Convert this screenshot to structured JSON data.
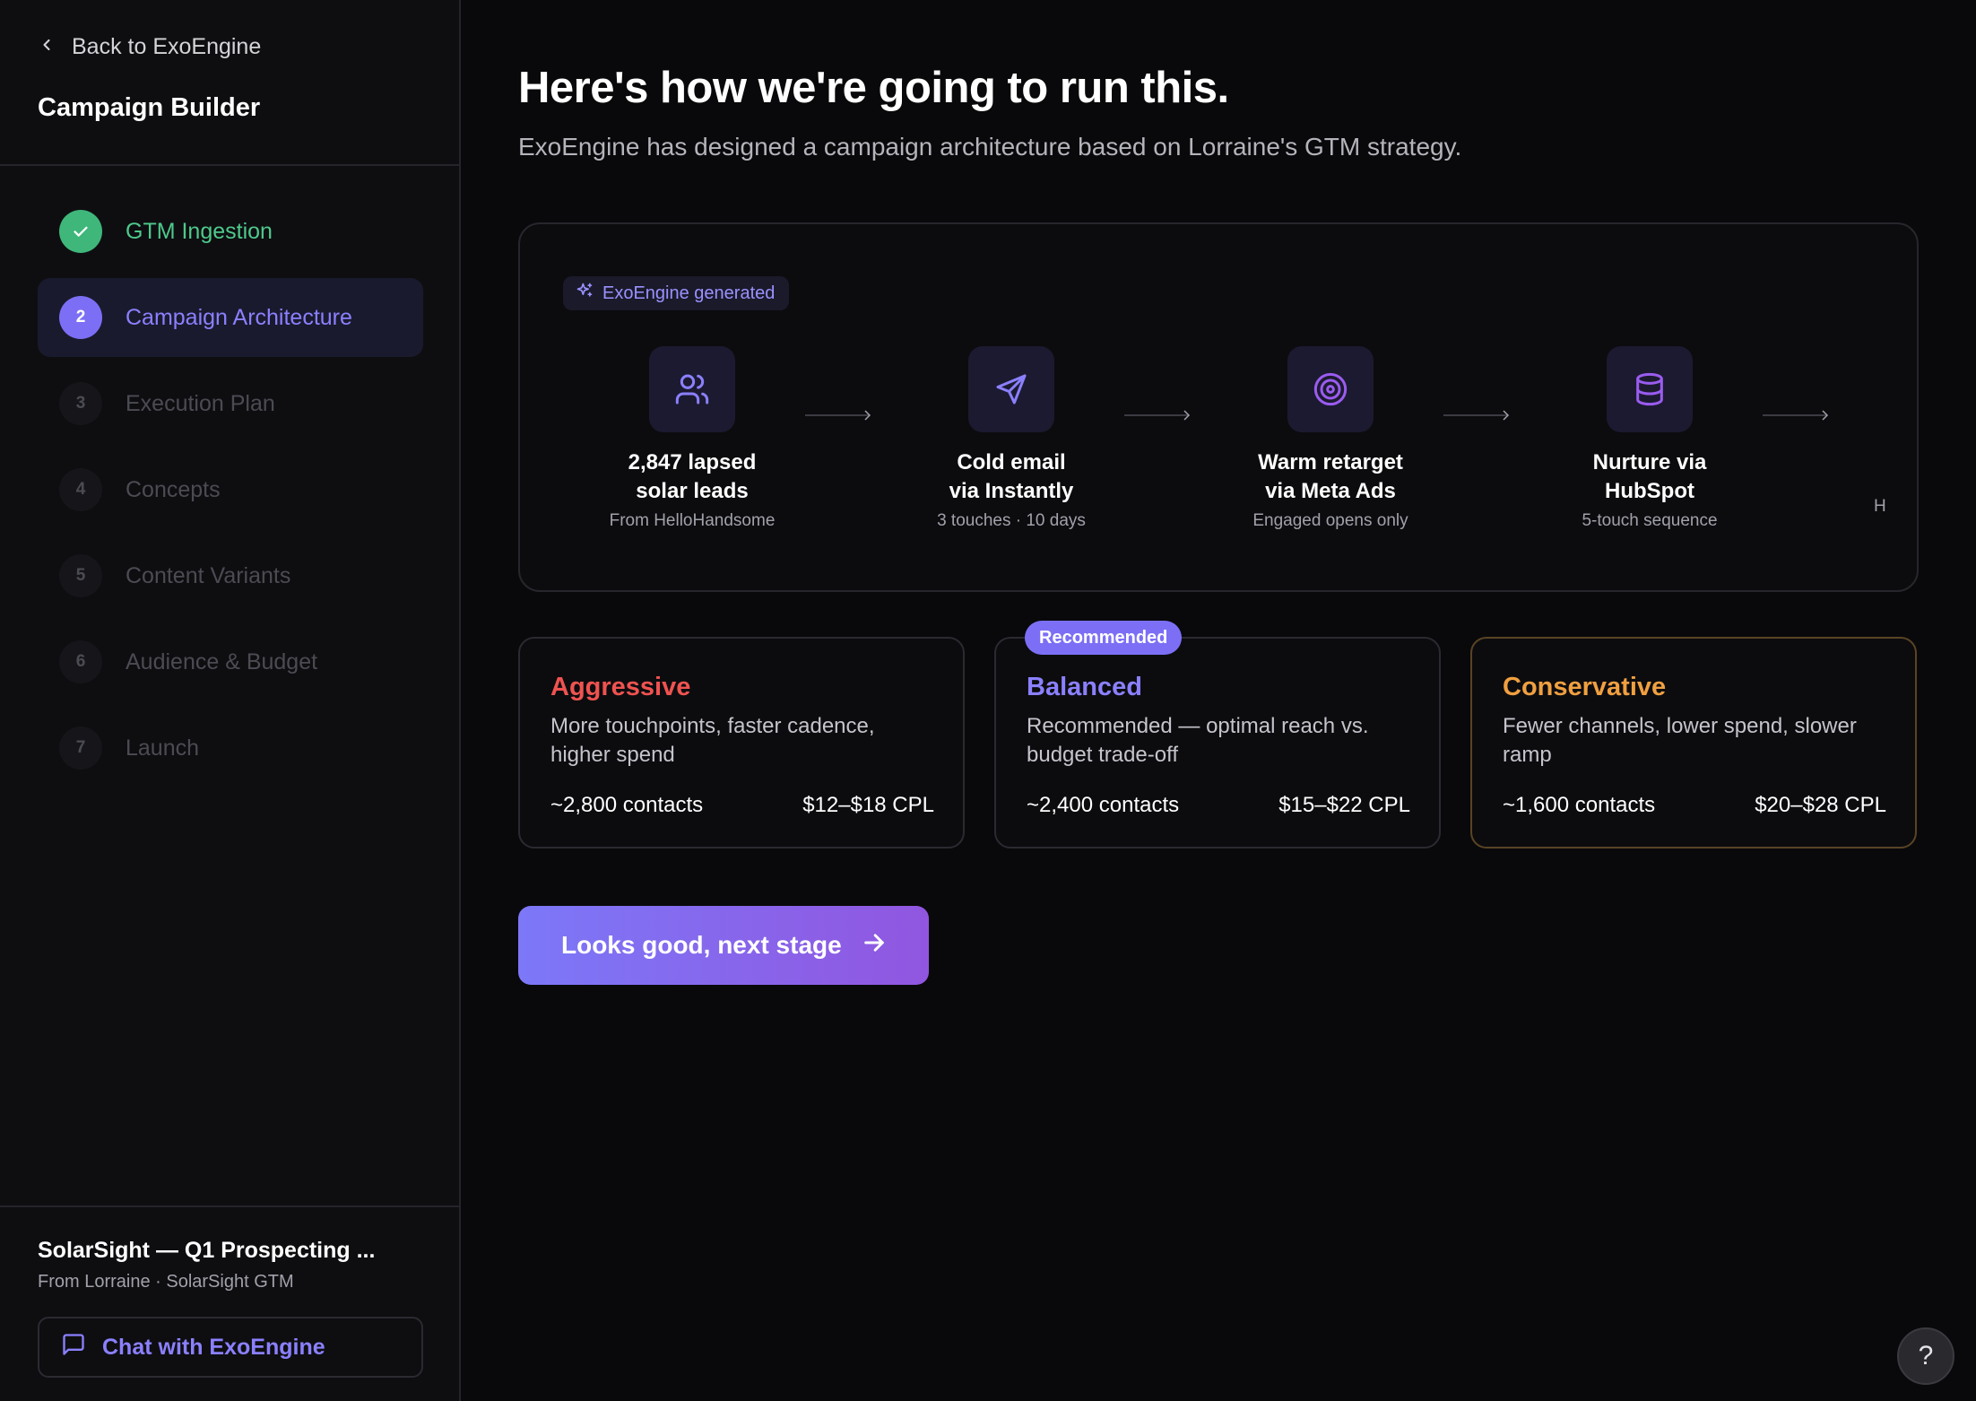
{
  "sidebar": {
    "back_label": "Back to ExoEngine",
    "title": "Campaign Builder",
    "steps": [
      {
        "num": "",
        "label": "GTM Ingestion",
        "state": "done"
      },
      {
        "num": "2",
        "label": "Campaign Architecture",
        "state": "active"
      },
      {
        "num": "3",
        "label": "Execution Plan",
        "state": "pending"
      },
      {
        "num": "4",
        "label": "Concepts",
        "state": "pending"
      },
      {
        "num": "5",
        "label": "Content Variants",
        "state": "pending"
      },
      {
        "num": "6",
        "label": "Audience & Budget",
        "state": "pending"
      },
      {
        "num": "7",
        "label": "Launch",
        "state": "pending"
      }
    ],
    "project_title": "SolarSight — Q1 Prospecting ...",
    "project_sub": "From Lorraine · SolarSight GTM",
    "chat_label": "Chat with ExoEngine"
  },
  "main": {
    "title": "Here's how we're going to run this.",
    "subtitle": "ExoEngine has designed a campaign architecture based on Lorraine's GTM strategy.",
    "badge": "ExoEngine generated",
    "flow": [
      {
        "name_line1": "2,847 lapsed",
        "name_line2": "solar leads",
        "meta": "From HelloHandsome",
        "icon": "users-icon"
      },
      {
        "name_line1": "Cold email",
        "name_line2": "via Instantly",
        "meta": "3 touches · 10 days",
        "icon": "send-icon"
      },
      {
        "name_line1": "Warm retarget",
        "name_line2": "via Meta Ads",
        "meta": "Engaged opens only",
        "icon": "target-icon"
      },
      {
        "name_line1": "Nurture via",
        "name_line2": "HubSpot",
        "meta": "5-touch sequence",
        "icon": "database-icon"
      }
    ],
    "flow_more": "H",
    "strategies": [
      {
        "name": "Aggressive",
        "desc": "More touchpoints, faster cadence, higher spend",
        "contacts": "~2,800 contacts",
        "cpl": "$12–$18 CPL",
        "color": "#ef5350"
      },
      {
        "name": "Balanced",
        "badge": "Recommended",
        "desc": "Recommended — optimal reach vs. budget trade-off",
        "contacts": "~2,400 contacts",
        "cpl": "$15–$22 CPL",
        "color": "#8b80ff"
      },
      {
        "name": "Conservative",
        "desc": "Fewer channels, lower spend, slower ramp",
        "contacts": "~1,600 contacts",
        "cpl": "$20–$28 CPL",
        "color": "#f0a040"
      }
    ],
    "cta_label": "Looks good, next stage",
    "help_label": "?"
  }
}
